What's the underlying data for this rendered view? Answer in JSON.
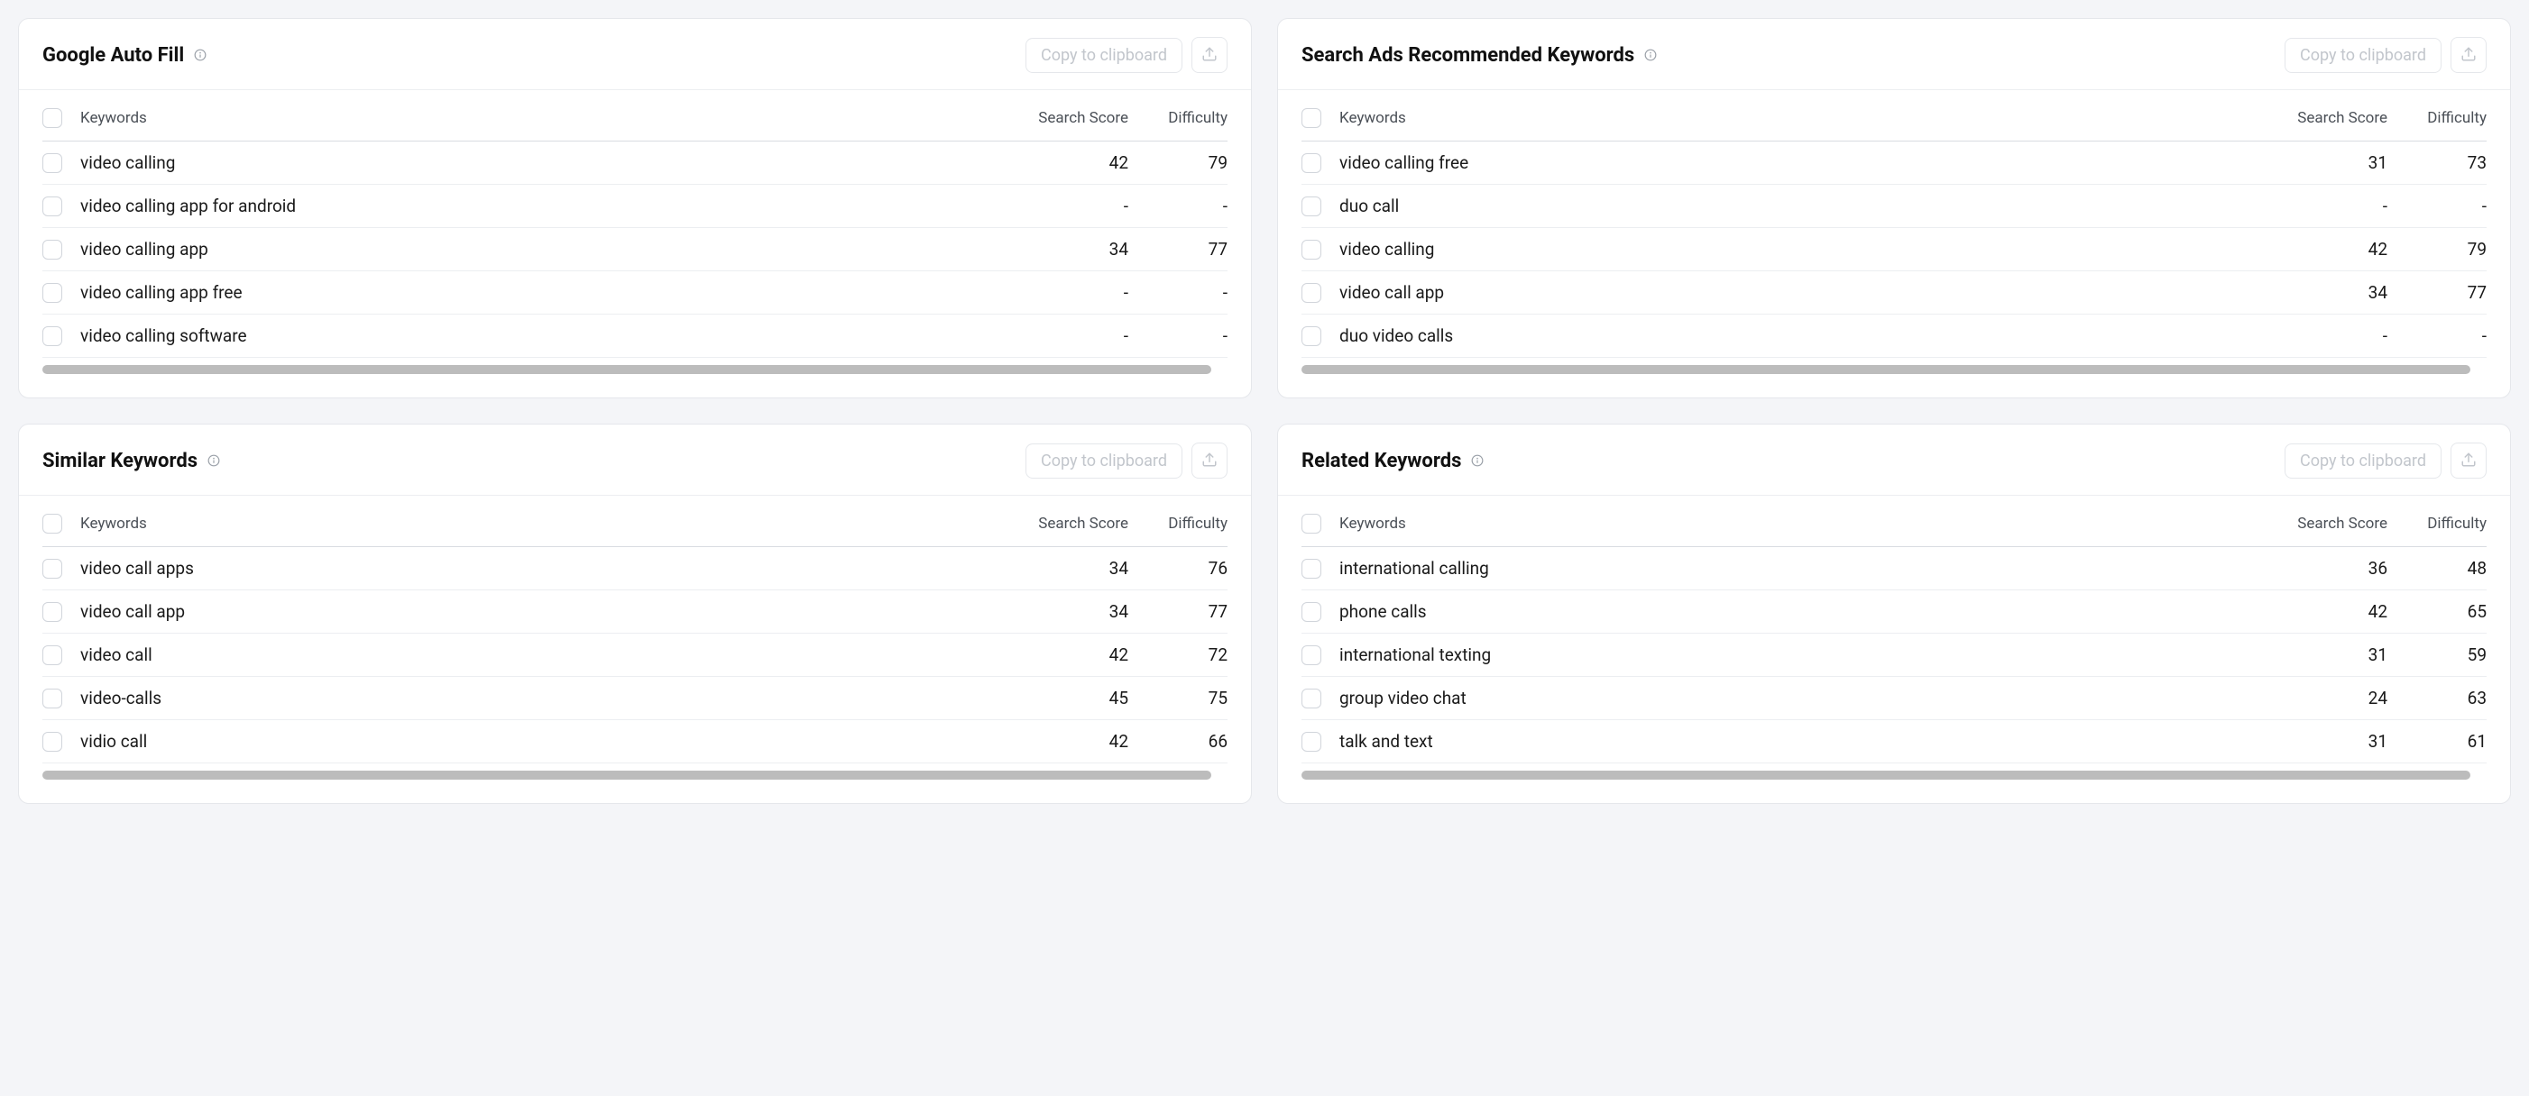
{
  "labels": {
    "copy": "Copy to clipboard",
    "col_keywords": "Keywords",
    "col_score": "Search Score",
    "col_diff": "Difficulty"
  },
  "cards": [
    {
      "title": "Google Auto Fill",
      "rows": [
        {
          "kw": "video calling",
          "score": "42",
          "diff": "79"
        },
        {
          "kw": "video calling app for android",
          "score": "-",
          "diff": "-"
        },
        {
          "kw": "video calling app",
          "score": "34",
          "diff": "77"
        },
        {
          "kw": "video calling app free",
          "score": "-",
          "diff": "-"
        },
        {
          "kw": "video calling software",
          "score": "-",
          "diff": "-"
        }
      ]
    },
    {
      "title": "Search Ads Recommended Keywords",
      "rows": [
        {
          "kw": "video calling free",
          "score": "31",
          "diff": "73"
        },
        {
          "kw": "duo call",
          "score": "-",
          "diff": "-"
        },
        {
          "kw": "video calling",
          "score": "42",
          "diff": "79"
        },
        {
          "kw": "video call app",
          "score": "34",
          "diff": "77"
        },
        {
          "kw": "duo video calls",
          "score": "-",
          "diff": "-"
        }
      ]
    },
    {
      "title": "Similar Keywords",
      "rows": [
        {
          "kw": "video call apps",
          "score": "34",
          "diff": "76"
        },
        {
          "kw": "video call app",
          "score": "34",
          "diff": "77"
        },
        {
          "kw": "video call",
          "score": "42",
          "diff": "72"
        },
        {
          "kw": "video-calls",
          "score": "45",
          "diff": "75"
        },
        {
          "kw": "vidio call",
          "score": "42",
          "diff": "66"
        }
      ]
    },
    {
      "title": "Related Keywords",
      "rows": [
        {
          "kw": "international calling",
          "score": "36",
          "diff": "48"
        },
        {
          "kw": "phone calls",
          "score": "42",
          "diff": "65"
        },
        {
          "kw": "international texting",
          "score": "31",
          "diff": "59"
        },
        {
          "kw": "group video chat",
          "score": "24",
          "diff": "63"
        },
        {
          "kw": "talk and text",
          "score": "31",
          "diff": "61"
        }
      ]
    }
  ]
}
